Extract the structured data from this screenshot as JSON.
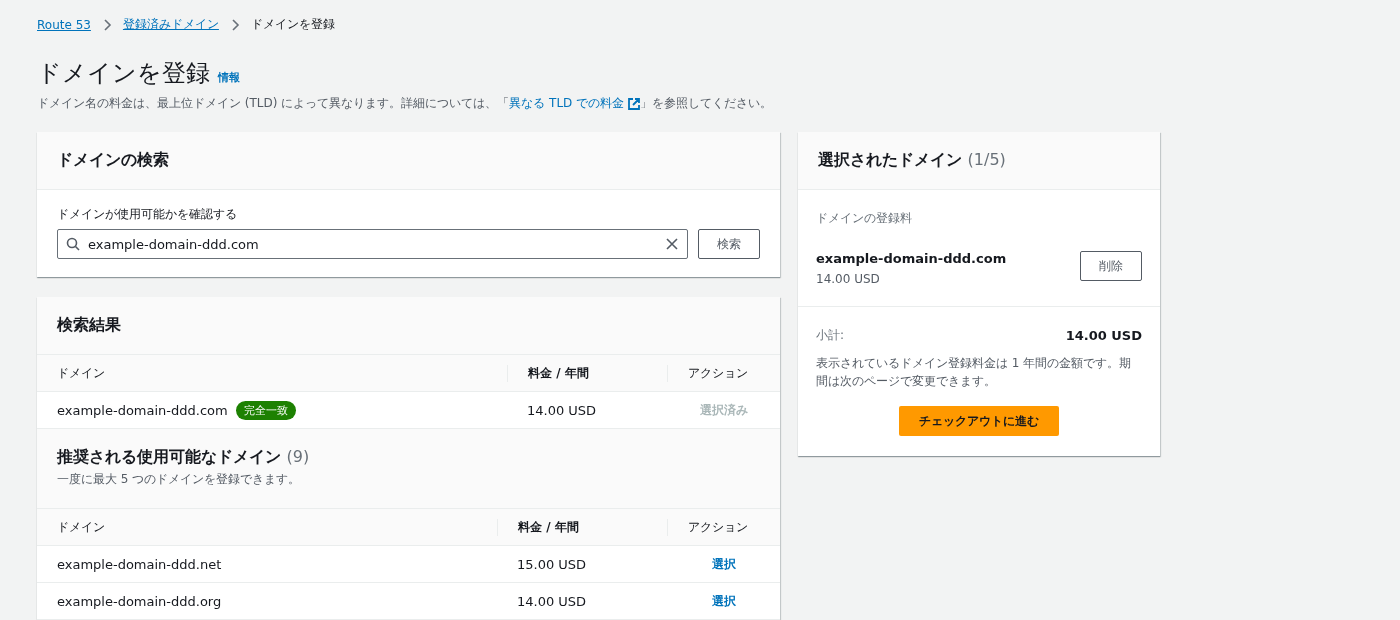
{
  "breadcrumb": [
    {
      "label": "Route 53",
      "link": true
    },
    {
      "label": "登録済みドメイン",
      "link": true
    },
    {
      "label": "ドメインを登録",
      "link": false
    }
  ],
  "page": {
    "title": "ドメインを登録",
    "info": "情報",
    "description_before": "ドメイン名の料金は、最上位ドメイン (TLD) によって異なります。詳細については、「",
    "description_link": "異なる TLD での料金",
    "description_after": "」を参照してください。"
  },
  "search_panel": {
    "title": "ドメインの検索",
    "label": "ドメインが使用可能かを確認する",
    "value": "example-domain-ddd.com",
    "button": "検索"
  },
  "results_panel": {
    "title": "検索結果",
    "columns": [
      "ドメイン",
      "料金 / 年間",
      "アクション"
    ],
    "rows": [
      {
        "domain": "example-domain-ddd.com",
        "badge": "完全一致",
        "price": "14.00 USD",
        "action": "選択済み",
        "selected": true
      }
    ],
    "suggested_title": "推奨される使用可能なドメイン",
    "suggested_count": "(9)",
    "suggested_note": "一度に最大 5 つのドメインを登録できます。",
    "suggested_columns": [
      "ドメイン",
      "料金 / 年間",
      "アクション"
    ],
    "suggested_rows": [
      {
        "domain": "example-domain-ddd.net",
        "price": "15.00 USD",
        "action": "選択",
        "selected": false
      },
      {
        "domain": "example-domain-ddd.org",
        "price": "14.00 USD",
        "action": "選択",
        "selected": false
      }
    ]
  },
  "cart": {
    "title": "選択されたドメイン",
    "count": "(1/5)",
    "section_label": "ドメインの登録料",
    "domain": "example-domain-ddd.com",
    "price": "14.00 USD",
    "remove": "削除",
    "subtotal_label": "小計:",
    "subtotal": "14.00 USD",
    "note": "表示されているドメイン登録料金は 1 年間の金額です。期間は次のページで変更できます。",
    "checkout": "チェックアウトに進む"
  }
}
